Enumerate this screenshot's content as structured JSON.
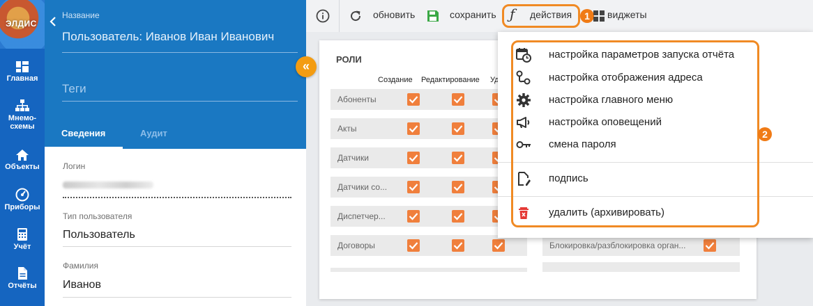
{
  "app": {
    "logo_text": "ЭЛДИС"
  },
  "nav": {
    "items": [
      {
        "label": "Главная",
        "icon": "dashboard-icon"
      },
      {
        "label": "Мнемо-\nсхемы",
        "icon": "hierarchy-icon"
      },
      {
        "label": "Объекты",
        "icon": "home-icon"
      },
      {
        "label": "Приборы",
        "icon": "gauge-icon"
      },
      {
        "label": "Учёт",
        "icon": "calculator-icon"
      },
      {
        "label": "Отчёты",
        "icon": "document-icon"
      }
    ]
  },
  "detail": {
    "name_caption": "Название",
    "name_value": "Пользователь: Иванов Иван Иванович",
    "tags_placeholder": "Теги",
    "tabs": [
      "Сведения",
      "Аудит"
    ],
    "fields": {
      "login_caption": "Логин",
      "type_caption": "Тип пользователя",
      "type_value": "Пользователь",
      "lastname_caption": "Фамилия",
      "lastname_value": "Иванов"
    }
  },
  "toolbar": {
    "refresh_label": "обновить",
    "save_label": "сохранить",
    "actions_label": "действия",
    "widgets_label": "виджеты",
    "badge_1": "1",
    "badge_2": "2"
  },
  "roles": {
    "title": "РОЛИ",
    "columns": [
      "Создание",
      "Редактирование",
      "Уд"
    ],
    "rows": [
      {
        "label": "Абоненты",
        "checks": [
          true,
          true,
          true
        ]
      },
      {
        "label": "Акты",
        "checks": [
          true,
          true,
          true
        ]
      },
      {
        "label": "Датчики",
        "checks": [
          true,
          true,
          true
        ]
      },
      {
        "label": "Датчики со...",
        "checks": [
          true,
          true,
          true
        ]
      },
      {
        "label": "Диспетчер...",
        "checks": [
          true,
          true,
          true
        ]
      },
      {
        "label": "Договоры",
        "checks": [
          true,
          true,
          true
        ]
      }
    ],
    "right_rows": [
      {
        "label": "Блокировка/разблокировка орган...",
        "checked": true
      }
    ]
  },
  "menu": {
    "items": [
      {
        "label": "настройка параметров запуска отчёта",
        "icon": "calendar-clock-icon"
      },
      {
        "label": "настройка отображения адреса",
        "icon": "map-pins-icon"
      },
      {
        "label": "настройка главного меню",
        "icon": "gear-icon"
      },
      {
        "label": "настройка оповещений",
        "icon": "megaphone-icon"
      },
      {
        "label": "смена пароля",
        "icon": "key-icon"
      },
      {
        "label": "подпись",
        "icon": "signature-icon"
      },
      {
        "label": "удалить (архивировать)",
        "icon": "trash-icon"
      }
    ]
  },
  "colors": {
    "nav_bg": "#1565c0",
    "header_bg": "#1a78c2",
    "accent": "#f08a24",
    "checkbox": "#f07f3c",
    "delete_icon": "#e53935"
  }
}
